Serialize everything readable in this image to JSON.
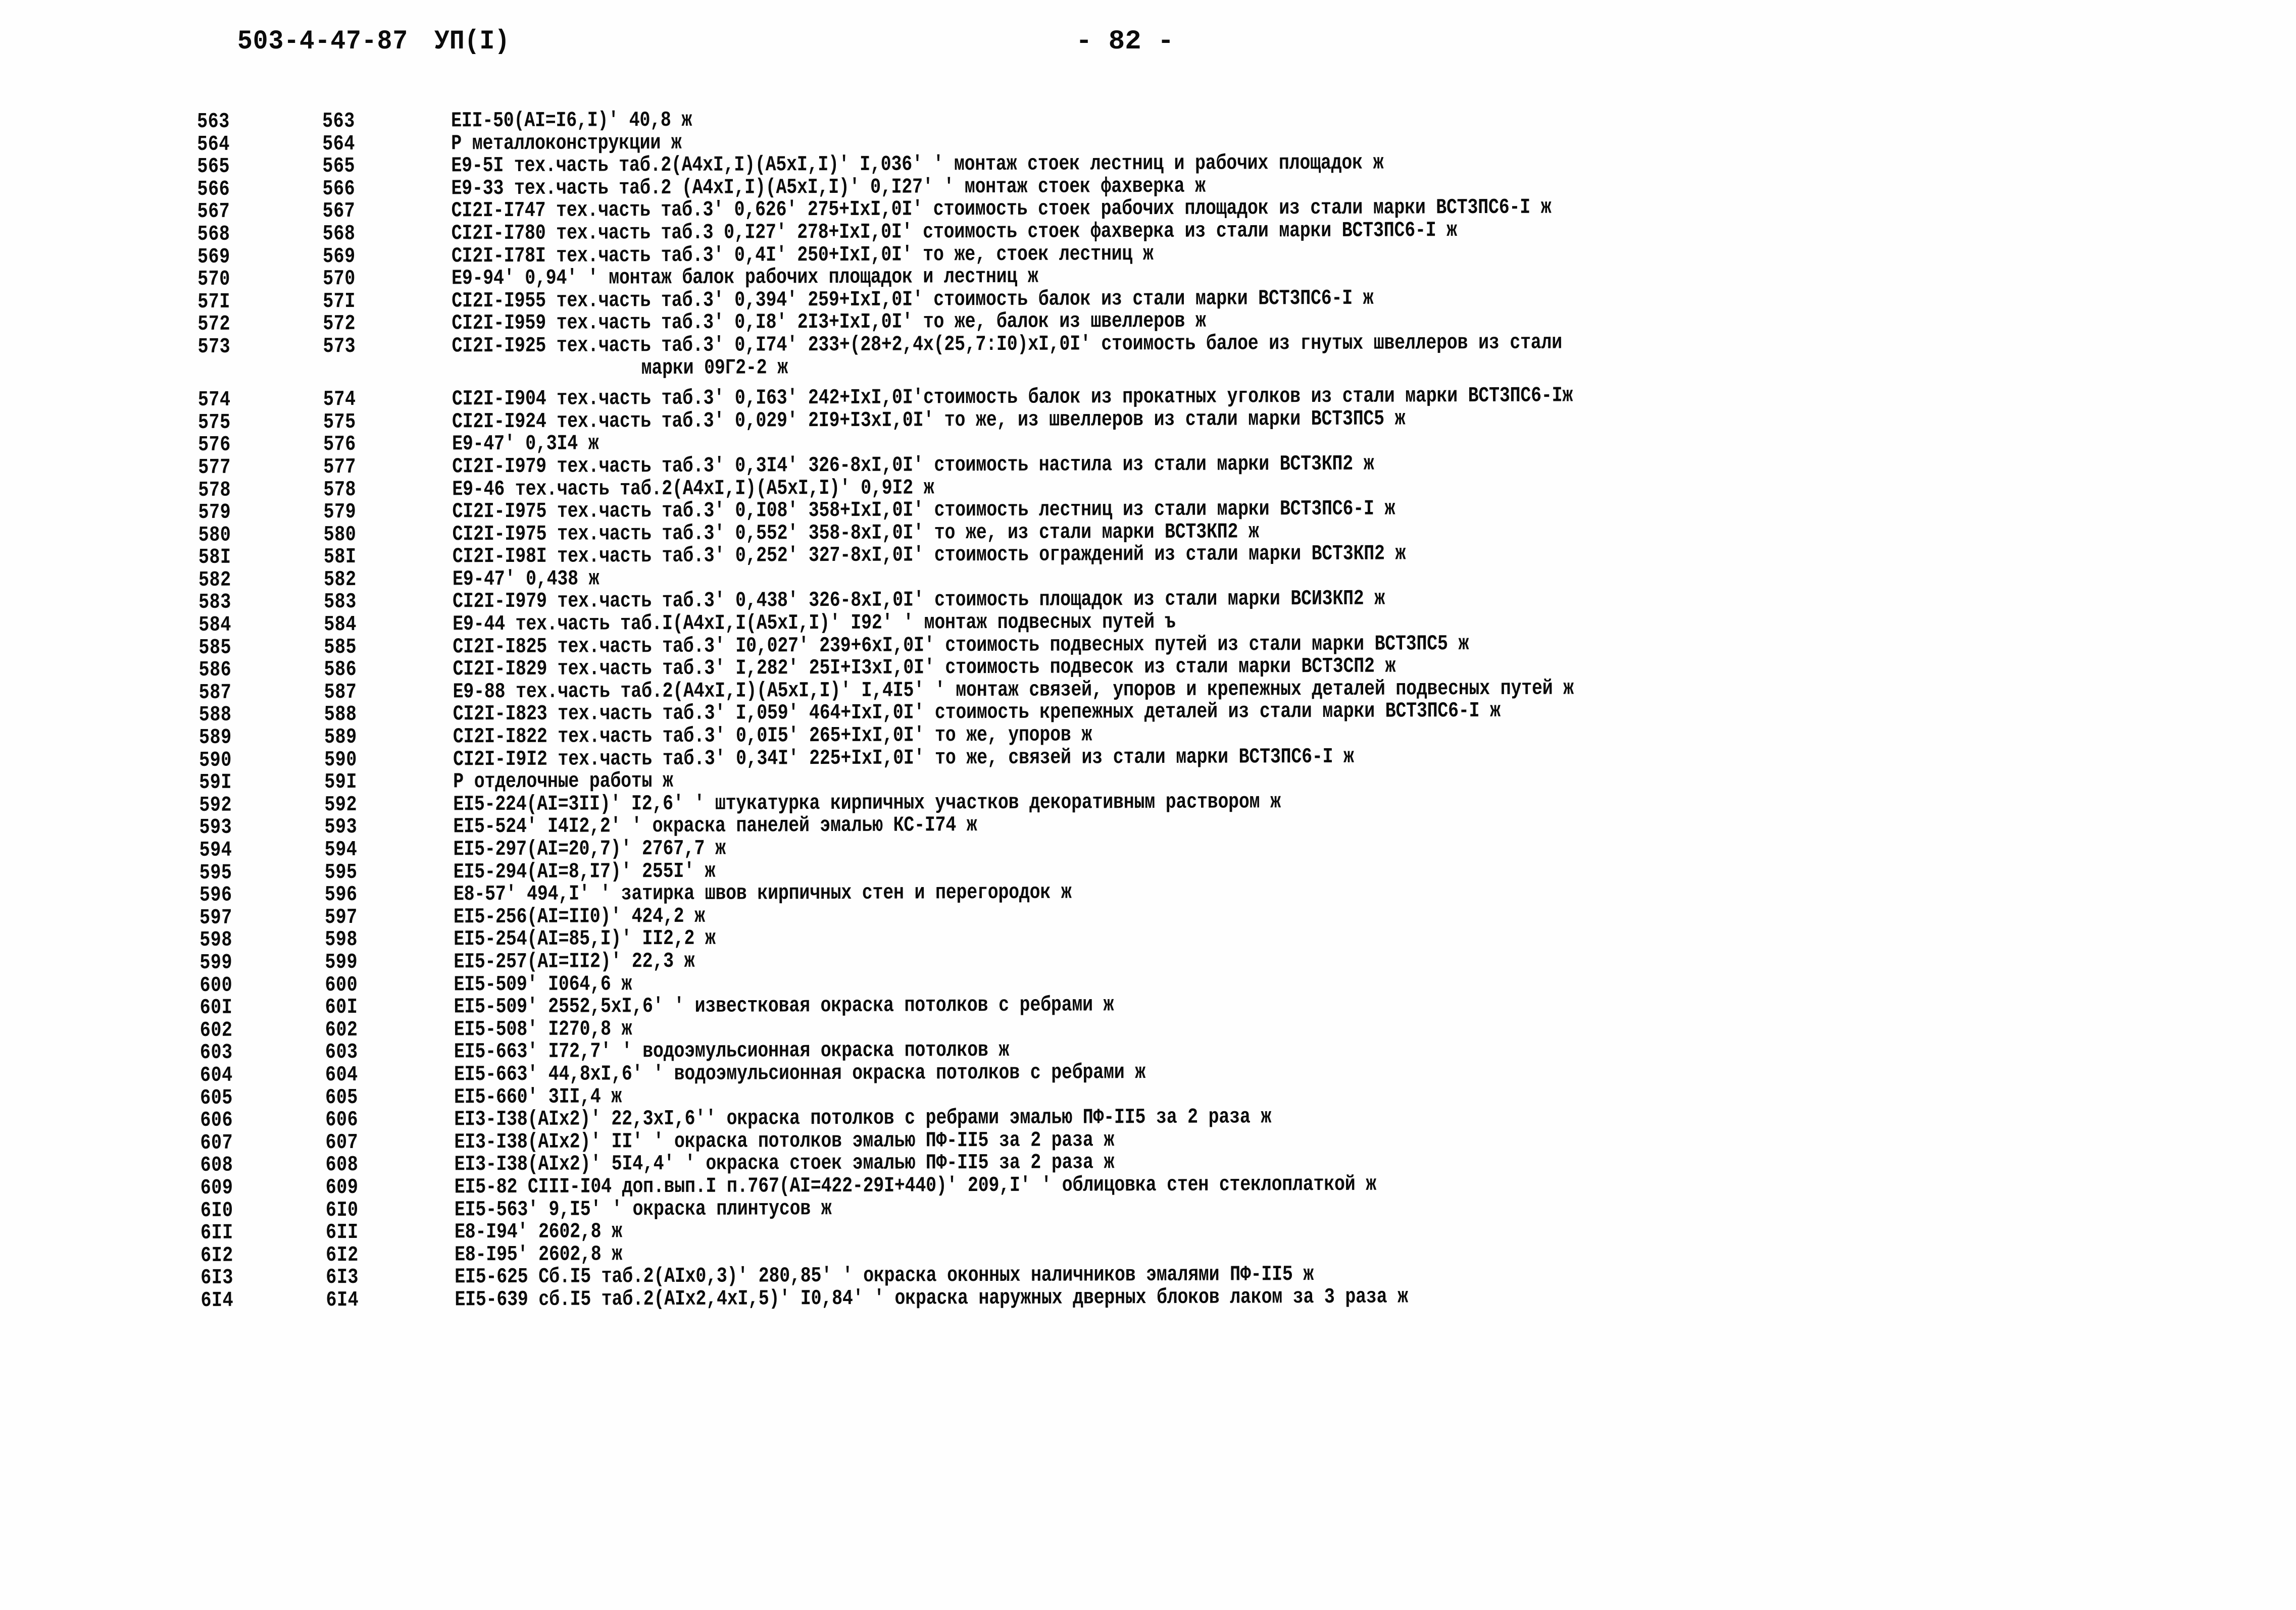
{
  "header": {
    "document_code": "503-4-47-87",
    "variant": "УП(I)",
    "page_number": "- 82 -"
  },
  "listing": {
    "columns": [
      "position_a",
      "position_b",
      "entry_text"
    ],
    "rows": [
      {
        "a": "563",
        "b": "563",
        "text": "EII-50(AI=I6,I)' 40,8 ж"
      },
      {
        "a": "564",
        "b": "564",
        "text": "Р металлоконструкции ж"
      },
      {
        "a": "565",
        "b": "565",
        "text": "E9-5I тех.часть таб.2(A4xI,I)(A5xI,I)' I,036' ' монтаж стоек лестниц и рабочих площадок ж"
      },
      {
        "a": "566",
        "b": "566",
        "text": "E9-33 тех.часть таб.2 (A4xI,I)(A5xI,I)' 0,I27' ' монтаж стоек фахверка ж"
      },
      {
        "a": "567",
        "b": "567",
        "text": "CI2I-I747 тех.часть таб.3' 0,626' 275+IxI,0I' стоимость стоек рабочих площадок из стали марки ВСТ3ПС6-I ж"
      },
      {
        "a": "568",
        "b": "568",
        "text": "CI2I-I780 тех.часть таб.3 0,I27' 278+IxI,0I' стоимость стоек фахверка из стали марки ВСТ3ПС6-I ж"
      },
      {
        "a": "569",
        "b": "569",
        "text": "CI2I-I78I тех.часть таб.3' 0,4I' 250+IxI,0I' то же, стоек лестниц ж"
      },
      {
        "a": "570",
        "b": "570",
        "text": "E9-94' 0,94' ' монтаж балок рабочих площадок и лестниц ж"
      },
      {
        "a": "57I",
        "b": "57I",
        "text": "CI2I-I955 тех.часть таб.3' 0,394' 259+IxI,0I' стоимость балок из стали марки ВСТ3ПС6-I ж"
      },
      {
        "a": "572",
        "b": "572",
        "text": "CI2I-I959 тех.часть таб.3' 0,I8' 2I3+IxI,0I' то же, балок из швеллеров ж"
      },
      {
        "a": "573",
        "b": "573",
        "text": "CI2I-I925 тех.часть таб.3' 0,I74' 233+(28+2,4x(25,7:I0)xI,0I' стоимость балое из гнутых швеллеров из стали"
      },
      {
        "a": "",
        "b": "",
        "text": "марки 09Г2-2 ж",
        "continuation": true
      },
      {
        "a": "574",
        "b": "574",
        "text": "CI2I-I904 тех.часть таб.3' 0,I63' 242+IxI,0I'стоимость балок из прокатных уголков из стали марки ВСТ3ПС6-Iж",
        "gap_before": true
      },
      {
        "a": "575",
        "b": "575",
        "text": "CI2I-I924 тех.часть таб.3' 0,029' 2I9+I3xI,0I' то же, из швеллеров из стали марки ВСТ3ПС5 ж"
      },
      {
        "a": "576",
        "b": "576",
        "text": "E9-47' 0,3I4 ж"
      },
      {
        "a": "577",
        "b": "577",
        "text": "CI2I-I979 тех.часть таб.3' 0,3I4' 326-8xI,0I' стоимость настила из стали марки ВСТ3КП2 ж"
      },
      {
        "a": "578",
        "b": "578",
        "text": "E9-46 тех.часть таб.2(A4xI,I)(A5xI,I)' 0,9I2 ж"
      },
      {
        "a": "579",
        "b": "579",
        "text": "CI2I-I975 тех.часть таб.3' 0,I08' 358+IxI,0I' стоимость лестниц из стали марки ВСТ3ПС6-I ж"
      },
      {
        "a": "580",
        "b": "580",
        "text": "CI2I-I975 тех.часть таб.3' 0,552' 358-8xI,0I' то же, из стали марки ВСТ3КП2 ж"
      },
      {
        "a": "58I",
        "b": "58I",
        "text": "CI2I-I98I тех.часть таб.3' 0,252' 327-8xI,0I' стоимость ограждений из стали марки ВСТ3КП2 ж"
      },
      {
        "a": "582",
        "b": "582",
        "text": "E9-47' 0,438 ж"
      },
      {
        "a": "583",
        "b": "583",
        "text": "CI2I-I979 тех.часть таб.3' 0,438' 326-8xI,0I' стоимость площадок из стали марки ВСИ3КП2 ж"
      },
      {
        "a": "584",
        "b": "584",
        "text": "E9-44 тех.часть таб.I(A4xI,I(A5xI,I)' I92' ' монтаж подвесных путей ъ"
      },
      {
        "a": "585",
        "b": "585",
        "text": "CI2I-I825 тех.часть таб.3' I0,027' 239+6xI,0I' стоимость подвесных путей из стали марки ВСТ3ПС5 ж"
      },
      {
        "a": "586",
        "b": "586",
        "text": "CI2I-I829 тех.часть таб.3' I,282' 25I+I3xI,0I' стоимость подвесок из стали марки ВСТ3СП2 ж"
      },
      {
        "a": "587",
        "b": "587",
        "text": "E9-88 тех.часть таб.2(A4xI,I)(A5xI,I)' I,4I5' ' монтаж связей, упоров и крепежных деталей подвесных путей ж"
      },
      {
        "a": "588",
        "b": "588",
        "text": "CI2I-I823 тех.часть таб.3' I,059' 464+IxI,0I' стоимость крепежных деталей из стали марки ВСТ3ПС6-I ж"
      },
      {
        "a": "589",
        "b": "589",
        "text": "CI2I-I822 тех.часть таб.3' 0,0I5' 265+IxI,0I' то же, упоров ж"
      },
      {
        "a": "590",
        "b": "590",
        "text": "CI2I-I9I2 тех.часть таб.3' 0,34I' 225+IxI,0I' то же, связей из стали марки ВСТ3ПС6-I ж"
      },
      {
        "a": "59I",
        "b": "59I",
        "text": "Р отделочные работы ж"
      },
      {
        "a": "592",
        "b": "592",
        "text": "EI5-224(AI=3II)' I2,6' ' штукатурка кирпичных участков декоративным раствором ж"
      },
      {
        "a": "593",
        "b": "593",
        "text": "EI5-524' I4I2,2' ' окраска панелей эмалью КС-I74 ж"
      },
      {
        "a": "594",
        "b": "594",
        "text": "EI5-297(AI=20,7)' 2767,7 ж"
      },
      {
        "a": "595",
        "b": "595",
        "text": "EI5-294(AI=8,I7)' 255I' ж"
      },
      {
        "a": "596",
        "b": "596",
        "text": "E8-57' 494,I' ' затирка швов кирпичных стен и перегородок ж"
      },
      {
        "a": "597",
        "b": "597",
        "text": "EI5-256(AI=II0)' 424,2 ж"
      },
      {
        "a": "598",
        "b": "598",
        "text": "EI5-254(AI=85,I)' II2,2 ж"
      },
      {
        "a": "599",
        "b": "599",
        "text": "EI5-257(AI=II2)' 22,3 ж"
      },
      {
        "a": "600",
        "b": "600",
        "text": "EI5-509' I064,6 ж"
      },
      {
        "a": "60I",
        "b": "60I",
        "text": "EI5-509' 2552,5xI,6' ' известковая окраска потолков с ребрами ж"
      },
      {
        "a": "602",
        "b": "602",
        "text": "EI5-508' I270,8 ж"
      },
      {
        "a": "603",
        "b": "603",
        "text": "EI5-663' I72,7' ' водоэмульсионная окраска потолков ж"
      },
      {
        "a": "604",
        "b": "604",
        "text": "EI5-663' 44,8xI,6' ' водоэмульсионная окраска потолков с ребрами ж"
      },
      {
        "a": "605",
        "b": "605",
        "text": "EI5-660' 3II,4 ж"
      },
      {
        "a": "606",
        "b": "606",
        "text": "EI3-I38(AIx2)' 22,3xI,6'' окраска потолков с ребрами эмалью ПФ-II5 за 2 раза ж"
      },
      {
        "a": "607",
        "b": "607",
        "text": "EI3-I38(AIx2)' II' ' окраска потолков эмалью ПФ-II5 за 2 раза ж"
      },
      {
        "a": "608",
        "b": "608",
        "text": "EI3-I38(AIx2)' 5I4,4' ' окраска стоек эмалью ПФ-II5 за 2 раза ж"
      },
      {
        "a": "609",
        "b": "609",
        "text": "EI5-82 CIII-I04 доп.вып.I п.767(AI=422-29I+440)' 209,I' ' облицовка стен стеклоплаткой ж"
      },
      {
        "a": "6I0",
        "b": "6I0",
        "text": "EI5-563' 9,I5' ' окраска плинтусов ж"
      },
      {
        "a": "6II",
        "b": "6II",
        "text": "E8-I94' 2602,8 ж"
      },
      {
        "a": "6I2",
        "b": "6I2",
        "text": "E8-I95' 2602,8 ж"
      },
      {
        "a": "6I3",
        "b": "6I3",
        "text": "EI5-625 Cб.I5 таб.2(AIx0,3)' 280,85' ' окраска оконных наличников эмалями ПФ-II5 ж"
      },
      {
        "a": "6I4",
        "b": "6I4",
        "text": "EI5-639 сб.I5 таб.2(AIx2,4xI,5)' I0,84' ' окраска наружных дверных блоков лаком за 3 раза ж"
      }
    ]
  }
}
